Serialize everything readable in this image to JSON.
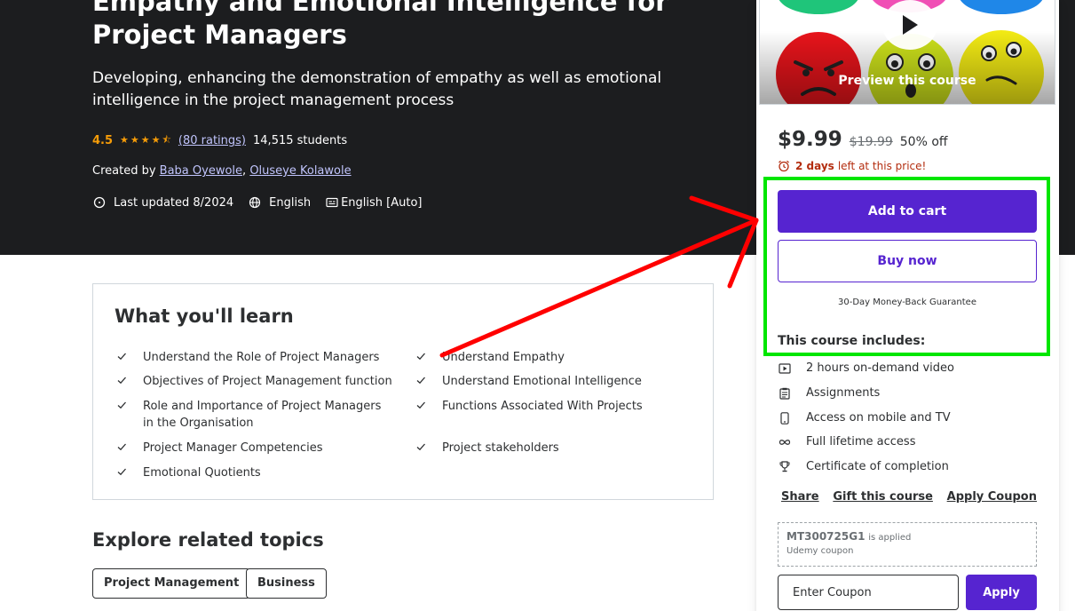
{
  "course": {
    "title": "Empathy and Emotional Intelligence for Project Managers",
    "subtitle": "Developing, enhancing the demonstration of empathy as well as emotional intelligence in the project management process",
    "rating": "4.5",
    "stars_value": 4.5,
    "ratings_count": "(80 ratings)",
    "students": "14,515 students",
    "created_by_label": "Created by",
    "authors": [
      "Baba Oyewole",
      "Oluseye Kolawole"
    ],
    "author_separator": ",",
    "last_updated": "Last updated 8/2024",
    "language": "English",
    "captions": "English [Auto]"
  },
  "learn": {
    "title": "What you'll learn",
    "items": [
      "Understand the Role of Project Managers",
      "Understand Empathy",
      "Objectives of Project Management function",
      "Understand Emotional Intelligence",
      "Role and Importance of Project Managers in the Organisation",
      "Functions Associated With Projects",
      "Project Manager Competencies",
      "Project stakeholders",
      "Emotional Quotients"
    ]
  },
  "explore": {
    "title": "Explore related topics",
    "topics": [
      "Project Management",
      "Business"
    ]
  },
  "sidebar": {
    "preview_label": "Preview this course",
    "price_now": "$9.99",
    "price_old": "$19.99",
    "discount": "50% off",
    "deadline_days": "2 days",
    "deadline_rest": "left at this price!",
    "add_to_cart": "Add to cart",
    "buy_now": "Buy now",
    "guarantee": "30-Day Money-Back Guarantee",
    "includes_title": "This course includes:",
    "includes": [
      {
        "icon": "video-icon",
        "label": "2 hours on-demand video"
      },
      {
        "icon": "assignment-icon",
        "label": "Assignments"
      },
      {
        "icon": "mobile-icon",
        "label": "Access on mobile and TV"
      },
      {
        "icon": "infinity-icon",
        "label": "Full lifetime access"
      },
      {
        "icon": "trophy-icon",
        "label": "Certificate of completion"
      }
    ],
    "links": {
      "share": "Share",
      "gift": "Gift this course",
      "apply_coupon": "Apply Coupon"
    },
    "coupon": {
      "code": "MT300725G1",
      "status": "is applied",
      "source": "Udemy coupon"
    },
    "coupon_placeholder": "Enter Coupon",
    "apply_label": "Apply"
  },
  "colors": {
    "hero_bg": "#1c1d1f",
    "accent": "#5624d0",
    "rating": "#f69c08",
    "link_on_dark": "#c0c4fc",
    "deadline": "#b32d0f",
    "annotation_box": "#00e600",
    "annotation_arrow": "#ff0000"
  }
}
